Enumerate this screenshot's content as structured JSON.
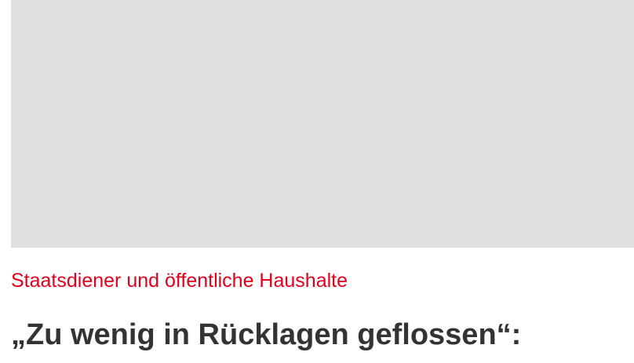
{
  "article": {
    "kicker": "Staatsdiener und öffentliche Haushalte",
    "headline": "„Zu wenig in Rücklagen geflossen“:"
  },
  "colors": {
    "kicker": "#e3001b",
    "headline": "#333333",
    "image_placeholder": "#e0e0e0"
  }
}
